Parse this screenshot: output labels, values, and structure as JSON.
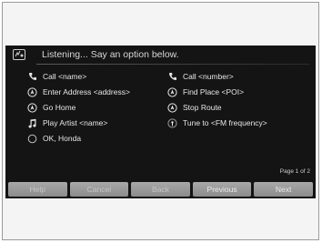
{
  "header": {
    "listening_text": "Listening... Say an option below."
  },
  "options": [
    {
      "label": "Call <name>",
      "icon": "phone-icon"
    },
    {
      "label": "Call <number>",
      "icon": "phone-icon"
    },
    {
      "label": "Enter Address <address>",
      "icon": "navigation-icon"
    },
    {
      "label": "Find Place <POI>",
      "icon": "navigation-icon"
    },
    {
      "label": "Go Home",
      "icon": "navigation-icon"
    },
    {
      "label": "Stop Route",
      "icon": "navigation-icon"
    },
    {
      "label": "Play Artist <name>",
      "icon": "music-note-icon"
    },
    {
      "label": "Tune to <FM frequency>",
      "icon": "radio-icon"
    },
    {
      "label": "OK, Honda",
      "icon": "voice-ring-icon"
    }
  ],
  "page_indicator": "Page 1 of 2",
  "buttons": {
    "help": "Help",
    "cancel": "Cancel",
    "back": "Back",
    "previous": "Previous",
    "next": "Next"
  },
  "colors": {
    "screen_bg": "#141414",
    "text": "#e6e6e6",
    "button_bg": "#9a9a9a"
  }
}
